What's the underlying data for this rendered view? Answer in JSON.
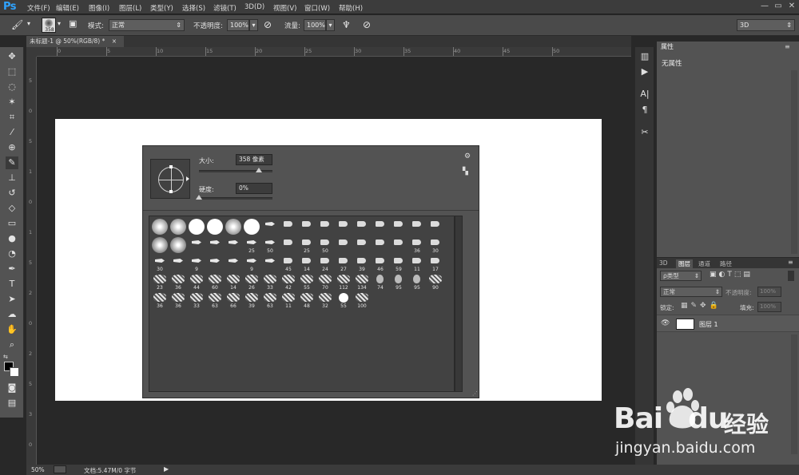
{
  "app": {
    "logo": "Ps"
  },
  "menu": [
    "文件(F)",
    "编辑(E)",
    "图像(I)",
    "图层(L)",
    "类型(Y)",
    "选择(S)",
    "滤镜(T)",
    "3D(D)",
    "视图(V)",
    "窗口(W)",
    "帮助(H)"
  ],
  "options": {
    "brush_size": "358",
    "mode_label": "模式:",
    "mode_value": "正常",
    "opacity_label": "不透明度:",
    "opacity_value": "100%",
    "flow_label": "流量:",
    "flow_value": "100%",
    "workspace": "3D"
  },
  "document": {
    "tab_title": "未标题-1 @ 50%(RGB/8) *",
    "close": "×"
  },
  "ruler": {
    "h": [
      "0",
      "5",
      "10",
      "15",
      "20",
      "25",
      "30",
      "35",
      "40",
      "45",
      "50"
    ],
    "v": [
      "5",
      "0",
      "5",
      "1",
      "0",
      "1",
      "5",
      "2",
      "0",
      "2",
      "5",
      "3",
      "0"
    ]
  },
  "brush_panel": {
    "size_label": "大小:",
    "size_value": "358 像素",
    "size_fraction": 0.82,
    "hardness_label": "硬度:",
    "hardness_value": "0%",
    "hardness_fraction": 0.0,
    "rows": [
      [
        "",
        "",
        "",
        "",
        "",
        "",
        "",
        "",
        "",
        "",
        "",
        "",
        "",
        "",
        "",
        ""
      ],
      [
        "",
        "",
        "",
        "",
        "",
        "25",
        "50",
        "",
        "25",
        "50",
        "",
        "",
        "",
        "",
        "36",
        "30"
      ],
      [
        "30",
        "",
        "9",
        "",
        "",
        "9",
        "",
        "45",
        "14",
        "24",
        "27",
        "39",
        "46",
        "59",
        "11",
        "17"
      ],
      [
        "23",
        "36",
        "44",
        "60",
        "14",
        "26",
        "33",
        "42",
        "55",
        "70",
        "112",
        "134",
        "74",
        "95",
        "95",
        "90"
      ],
      [
        "36",
        "36",
        "33",
        "63",
        "66",
        "39",
        "63",
        "11",
        "48",
        "32",
        "55",
        "100",
        "",
        "",
        "",
        ""
      ]
    ]
  },
  "right_panel": {
    "properties_tab": "属性",
    "no_properties": "无属性",
    "layer_tabs": [
      "3D",
      "图层",
      "通道",
      "路径"
    ],
    "filter_label": "ρ类型",
    "blend_mode": "正常",
    "opacity_label": "不透明度:",
    "opacity_value": "100%",
    "lock_label": "锁定:",
    "fill_label": "填充:",
    "fill_value": "100%",
    "layer_name": "图层 1"
  },
  "status": {
    "zoom": "50%",
    "doc_info": "文档:5.47M/0 字节"
  },
  "watermark": {
    "logo_text": "Bai",
    "logo_text2": "du",
    "brand": "经验",
    "url": "jingyan.baidu.com"
  }
}
